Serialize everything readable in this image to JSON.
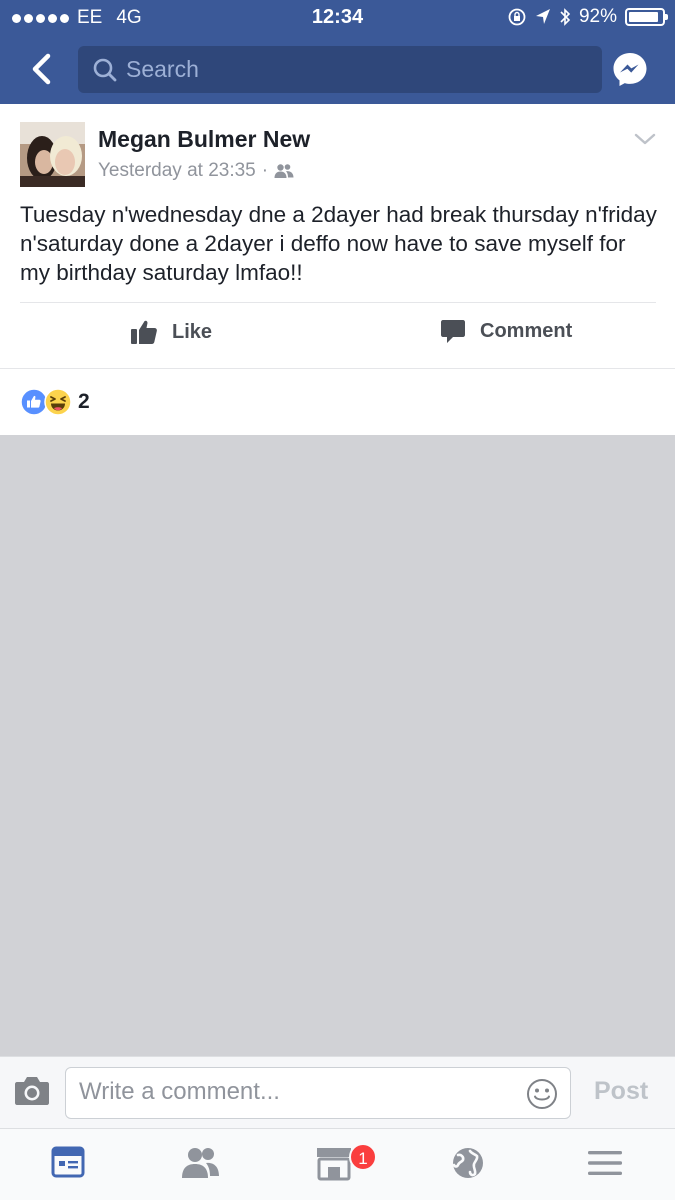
{
  "status_bar": {
    "carrier": "EE",
    "network": "4G",
    "time": "12:34",
    "battery": "92%",
    "battery_level": 0.92
  },
  "nav": {
    "search_placeholder": "Search"
  },
  "post": {
    "author": "Megan Bulmer New",
    "timestamp": "Yesterday at 23:35",
    "separator": "·",
    "audience_icon": "friends-icon",
    "text": "Tuesday n'wednesday dne a 2dayer had break thursday n'friday n'saturday done a 2dayer i deffo now have to save myself for my birthday saturday lmfao!!",
    "actions": {
      "like_label": "Like",
      "comment_label": "Comment"
    },
    "reactions": {
      "types": [
        "like",
        "haha"
      ],
      "count": "2"
    }
  },
  "comment_bar": {
    "placeholder": "Write a comment...",
    "post_label": "Post"
  },
  "tab_bar": {
    "tabs": [
      "news-feed-icon",
      "friends-icon",
      "marketplace-icon",
      "notifications-globe-icon",
      "menu-icon"
    ],
    "badge": "1"
  },
  "colors": {
    "brand": "#3b5998",
    "active_tab": "#4267b2",
    "badge": "#fa3e3e"
  }
}
